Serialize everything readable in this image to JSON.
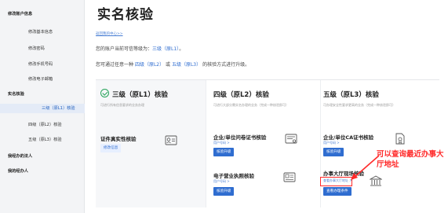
{
  "sidebar": {
    "items": [
      {
        "label": "修改账户信息"
      },
      {
        "label": "修改基本信息"
      },
      {
        "label": "修改密码"
      },
      {
        "label": "修改手机号码"
      },
      {
        "label": "修改电子邮箱"
      },
      {
        "label": "实名核验"
      },
      {
        "label": "三级（原L1）核验"
      },
      {
        "label": "四级（原L2）核验"
      },
      {
        "label": "五级（原L3）核验"
      },
      {
        "label": "我经办的法人"
      },
      {
        "label": "我的经办人"
      }
    ]
  },
  "main": {
    "title": "实名核验",
    "small_link": "返回我的中心>>",
    "level_line": {
      "prefix": "您的账户当前可信等级为：",
      "value": "三级（原L1）",
      "link": "。"
    },
    "upgrade_line": {
      "prefix": "您可通过任意一种",
      "opt1": "四级（原L2）",
      "mid": "或",
      "opt2": "五级（原L3）",
      "suffix": "的核验方式进行升级。"
    }
  },
  "columns": [
    {
      "title": "三级（原L1）核验",
      "desc": "可进行所有信息要求的业务办理",
      "items": [
        {
          "title": "证件真实性核验",
          "button": "修改信息"
        }
      ]
    },
    {
      "title": "四级（原L2）核验",
      "desc": "可进行大部分需实名办理的业务（完成一种核验即可）",
      "items": [
        {
          "title": "企业/单位问卷证书核验",
          "sub": "用户号码 >",
          "button": "核验升级"
        },
        {
          "title": "电子营业执照核验",
          "sub": "用户号码 >",
          "button": "核验升级"
        }
      ]
    },
    {
      "title": "五级（原L3）核验",
      "desc": "可办理安全性要求更高的业务（完成一种核验即可）",
      "items": [
        {
          "title": "企业/单位CA证书核验",
          "sub": "用户号码 >",
          "button": "核验升级"
        },
        {
          "title": "办事大厅现场核验",
          "sub": "查看办事大厅地址 >",
          "button": "查看办理条件"
        }
      ]
    }
  ],
  "annotation": "可以查询最近办事大厅地址",
  "colors": {
    "accent": "#2f6dd0",
    "success": "#27a35a",
    "annotation": "#ff2a2a"
  }
}
